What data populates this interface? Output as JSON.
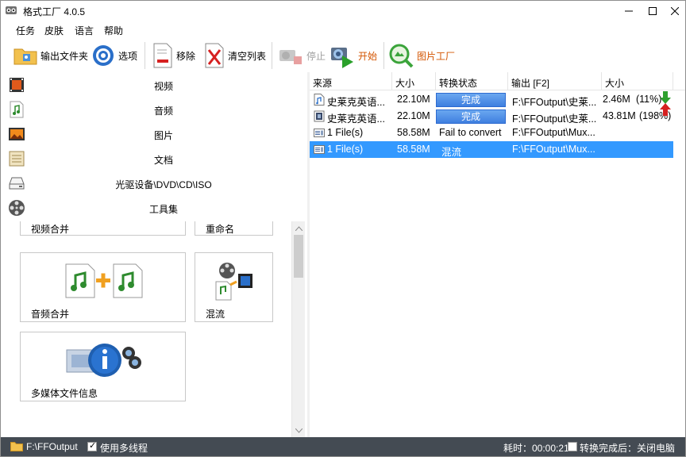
{
  "window": {
    "title": "格式工厂 4.0.5"
  },
  "menu": [
    "任务",
    "皮肤",
    "语言",
    "帮助"
  ],
  "toolbar": {
    "output_folder": "输出文件夹",
    "options": "选项",
    "remove": "移除",
    "clear_list": "清空列表",
    "stop": "停止",
    "start": "开始",
    "picture_factory": "图片工厂"
  },
  "categories": [
    "视频",
    "音频",
    "图片",
    "文档",
    "光驱设备\\DVD\\CD\\ISO",
    "工具集"
  ],
  "tools": {
    "video_merge": "视频合并",
    "rename": "重命名",
    "audio_merge": "音频合并",
    "mux": "混流",
    "media_info": "多媒体文件信息"
  },
  "scrollbar": {
    "position": 0.0
  },
  "file_list": {
    "columns": [
      "来源",
      "大小",
      "转换状态",
      "输出 [F2]",
      "大小"
    ],
    "rows": [
      {
        "source": "史莱克英语...",
        "size": "22.10M",
        "status": "完成",
        "output": "F:\\FFOutput\\史莱...",
        "out_size": "2.46M",
        "ratio": "(11%)",
        "icon": "audio-file-icon",
        "trend": "down"
      },
      {
        "source": "史莱克英语...",
        "size": "22.10M",
        "status": "完成",
        "output": "F:\\FFOutput\\史莱...",
        "out_size": "43.81M",
        "ratio": "(198%)",
        "icon": "video-file-icon",
        "trend": "up"
      },
      {
        "source": "1 File(s)",
        "size": "58.58M",
        "status": "Fail to convert",
        "output": "F:\\FFOutput\\Mux...",
        "out_size": "",
        "ratio": "",
        "icon": "multi-file-icon"
      },
      {
        "source": "1 File(s)",
        "size": "58.58M",
        "status": "混流",
        "output": "F:\\FFOutput\\Mux...",
        "out_size": "",
        "ratio": "",
        "icon": "multi-file-icon",
        "selected": true
      }
    ]
  },
  "statusbar": {
    "output_path": "F:\\FFOutput",
    "multithread_label": "使用多线程",
    "multithread_checked": true,
    "elapsed": "耗时：00:00:21",
    "after_convert_label": "转换完成后：关闭电脑",
    "after_convert_checked": false
  },
  "colors": {
    "selected_row": "#3399ff",
    "status_bar": "#444b53",
    "accent_orange": "#d35400"
  }
}
